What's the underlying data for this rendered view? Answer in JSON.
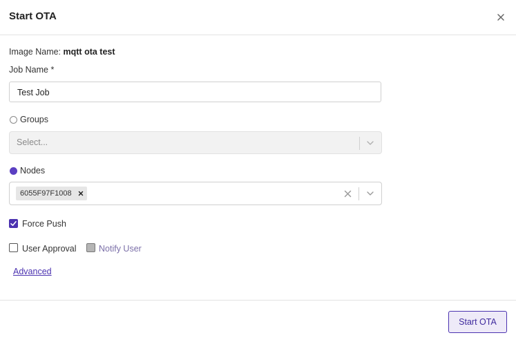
{
  "dialog": {
    "title": "Start OTA"
  },
  "form": {
    "image_name_label": "Image Name:",
    "image_name_value": "mqtt ota test",
    "job_name_label": "Job Name *",
    "job_name_value": "Test Job",
    "groups": {
      "label": "Groups",
      "selected": false,
      "placeholder": "Select..."
    },
    "nodes": {
      "label": "Nodes",
      "selected": true,
      "chips": [
        "6055F97F1008"
      ]
    },
    "force_push": {
      "label": "Force Push",
      "checked": true
    },
    "user_approval": {
      "label": "User Approval",
      "checked": false
    },
    "notify_user": {
      "label": "Notify User",
      "checked": false,
      "disabled": true
    },
    "advanced_link": "Advanced"
  },
  "footer": {
    "submit_label": "Start OTA"
  },
  "colors": {
    "accent": "#4b32b0",
    "radio_selected": "#5b3fc2",
    "button_bg": "#eeeaf8"
  },
  "icons": {
    "close": "close-icon",
    "chevron": "chevron-down-icon",
    "clear": "clear-icon"
  }
}
